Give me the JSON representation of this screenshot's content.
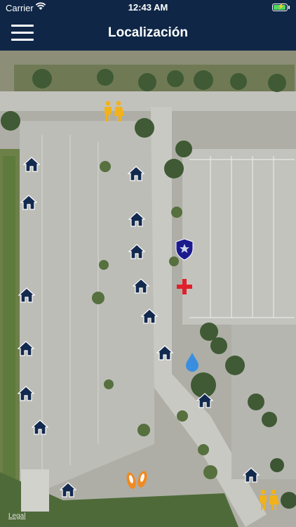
{
  "status_bar": {
    "carrier": "Carrier",
    "time": "12:43 AM",
    "battery_level": 1.0
  },
  "header": {
    "title": "Localización",
    "menu_icon": "hamburger-menu-icon"
  },
  "map": {
    "legal_label": "Legal",
    "markers": [
      {
        "name": "restroom-icon",
        "label": "Restrooms"
      },
      {
        "name": "house-icon"
      },
      {
        "name": "police-icon"
      },
      {
        "name": "first-aid-icon"
      },
      {
        "name": "water-drop-icon"
      },
      {
        "name": "footprints-icon"
      }
    ]
  },
  "colors": {
    "header_bg": "#0f2646",
    "house_marker": "#132a4f",
    "police_marker": "#1b1b8f",
    "first_aid": "#e0202b",
    "water": "#3a8ee0",
    "restroom": "#f2b21a",
    "footprints": "#f08a22"
  }
}
